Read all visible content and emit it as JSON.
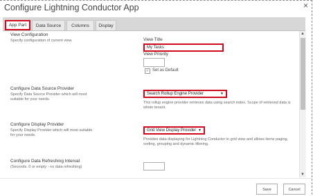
{
  "window": {
    "title": "Configure Lightning Conductor App",
    "close_glyph": "×"
  },
  "tabs": [
    {
      "label": "App Part",
      "active": true
    },
    {
      "label": "Data Source",
      "active": false
    },
    {
      "label": "Columns",
      "active": false
    },
    {
      "label": "Display",
      "active": false
    }
  ],
  "view_config": {
    "title": "View Configuration",
    "desc": "Specify configuration of current view.",
    "view_title_label": "View Title",
    "view_title_value": "My Tasks",
    "view_priority_label": "View Priority",
    "view_priority_value": "",
    "set_default_label": "Set as Default",
    "set_default_checked": true
  },
  "data_source": {
    "title": "Configure Data Source Provider",
    "desc": "Specify Data Source Provider which will most suitable for your needs.",
    "selected": "Search Rollup Engine Provider",
    "help": "This rollup engine provider retrieves data using search index. Scope of retrieved data is whole tenant."
  },
  "display_provider": {
    "title": "Configure Display Provider",
    "desc": "Specify Display Provider which will most suitable for your needs.",
    "selected": "Grid View Display Provider",
    "help": "Provides data displaying for Lightning Conductor in grid view and allows items paging, sorting, grouping and dynamic filtering."
  },
  "refresh": {
    "title": "Configure Data Refreshing Interval",
    "desc": "(Seconds. 0 or empty - no data refreshing)",
    "value": ""
  },
  "footer": {
    "save_label": "Save",
    "cancel_label": "Cancel"
  },
  "colors": {
    "highlight": "#d0061b",
    "tabbar": "#d7d7d7"
  },
  "icons": {
    "dropdown": "chevron-down-icon",
    "scroll_up": "up-arrow-icon",
    "scroll_down": "down-arrow-icon"
  }
}
